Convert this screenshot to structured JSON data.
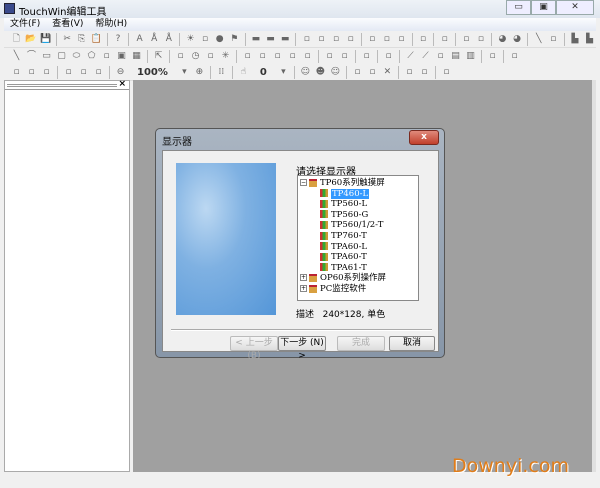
{
  "window": {
    "title": "TouchWin编辑工具",
    "minimize": "▭",
    "maximize": "▣",
    "close": "✕"
  },
  "menu": [
    "文件(F)",
    "查看(V)",
    "帮助(H)"
  ],
  "toolbar": {
    "row1": [
      "new-file",
      "open-folder",
      "save",
      "|",
      "cut",
      "copy",
      "paste",
      "|",
      "help",
      "|",
      "text",
      "text-a",
      "text-aa",
      "|",
      "lamp",
      "shape-blob",
      "circle-fill",
      "flag",
      "|",
      "rect-btn",
      "rect-btn",
      "rect-btn",
      "|",
      "num-123",
      "num-box",
      "num-box2",
      "num-box3",
      "|",
      "keyboard",
      "printer",
      "info",
      "|",
      "battery",
      "|",
      "eraser",
      "|",
      "monitor",
      "window",
      "|",
      "globe",
      "globe2",
      "|",
      "line",
      "grid",
      "|",
      "bar-chart",
      "bar-chart2"
    ],
    "row2": [
      "line",
      "arc",
      "rectangle",
      "rounded-rect",
      "ellipse",
      "pentagon",
      "bowl",
      "frame",
      "image",
      "|",
      "pointer",
      "|",
      "recipe",
      "clock",
      "speaker",
      "sun",
      "|",
      "meter",
      "picture",
      "alarm",
      "scroll",
      "report",
      "|",
      "data-edit",
      "screen-edit",
      "|",
      "monitor-set",
      "|",
      "report2",
      "|",
      "trend",
      "trend2",
      "bar-small",
      "table",
      "table2",
      "|",
      "tools",
      "|",
      "folder"
    ],
    "row3": [
      "align-left",
      "align-center",
      "align-right",
      "|",
      "distribute-v",
      "distribute-h",
      "distribute-c",
      "|",
      "zoom-out",
      "zoom-level",
      "dropdown",
      "zoom-in",
      "|",
      "grid-dots",
      "|",
      "hand",
      "layer-value",
      "dropdown",
      "|",
      "face",
      "face2",
      "face3",
      "|",
      "copy-frame",
      "copy-frame2",
      "delete",
      "|",
      "network",
      "network2",
      "|",
      "keyboard-box"
    ],
    "zoom": "100%",
    "layer": "0"
  },
  "left_panel": {
    "close": "×"
  },
  "dialog": {
    "title": "显示器",
    "close": "x",
    "prompt": "请选择显示器",
    "tree": [
      {
        "label": "TP60系列触摸屏",
        "expanded": true,
        "children": [
          "TP460-L",
          "TP560-L",
          "TP560-G",
          "TP560/1/2-T",
          "TP760-T",
          "TPA60-L",
          "TPA60-T",
          "TPA61-T"
        ],
        "selected": "TP460-L"
      },
      {
        "label": "OP60系列操作屏",
        "expanded": false
      },
      {
        "label": "PC监控软件",
        "expanded": false
      }
    ],
    "desc_label": "描述",
    "desc_value": "240*128, 单色",
    "buttons": {
      "back": "< 上一步 (B)",
      "next": "下一步 (N) >",
      "finish": "完成",
      "cancel": "取消"
    }
  },
  "watermark": "Downyi.com"
}
